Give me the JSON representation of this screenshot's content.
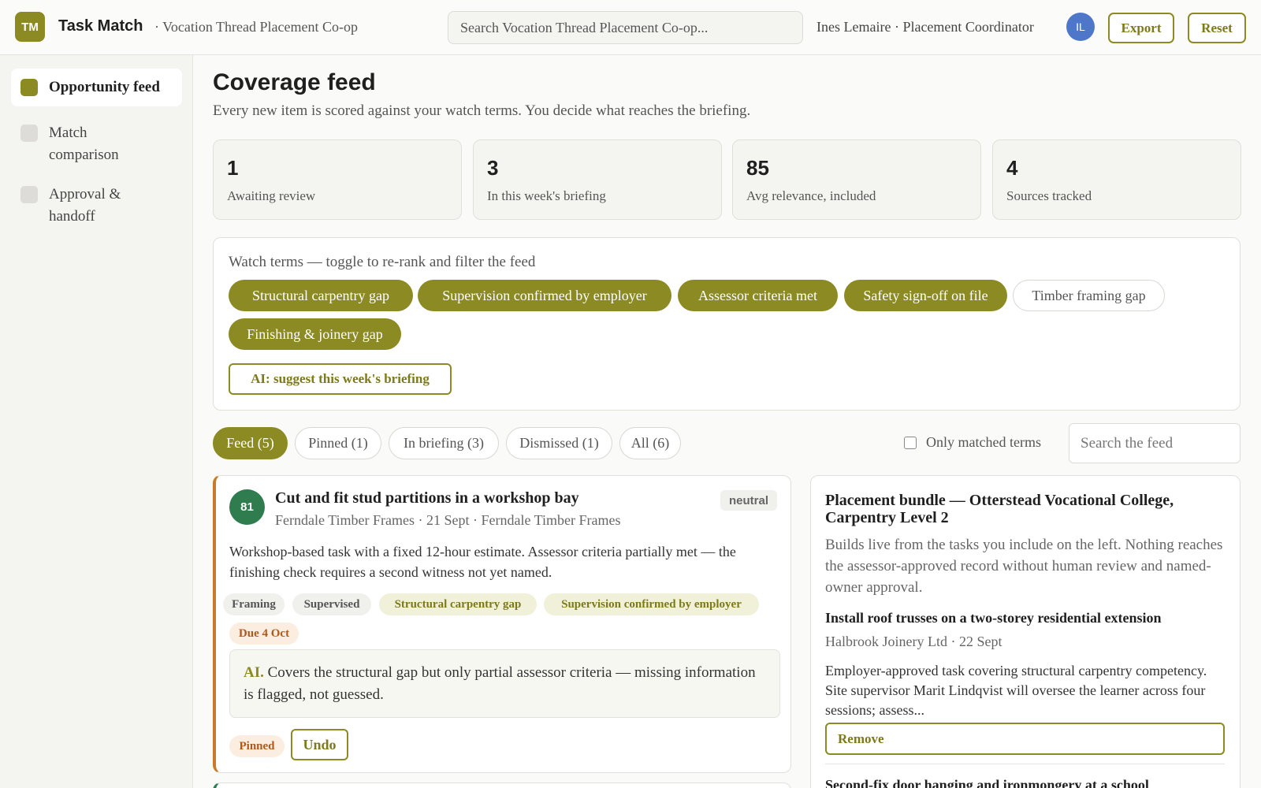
{
  "header": {
    "logo_text": "TM",
    "app_name": "Task Match",
    "org_name": "· Vocation Thread Placement Co-op",
    "search_placeholder": "Search Vocation Thread Placement Co-op...",
    "user": "Ines Lemaire · Placement Coordinator",
    "avatar_initials": "IL",
    "export_label": "Export",
    "reset_label": "Reset"
  },
  "sidebar": {
    "items": [
      {
        "label": "Opportunity feed",
        "active": true
      },
      {
        "label": "Match comparison",
        "active": false
      },
      {
        "label": "Approval & handoff",
        "active": false
      }
    ]
  },
  "main": {
    "title": "Coverage feed",
    "subtitle": "Every new item is scored against your watch terms. You decide what reaches the briefing.",
    "stats": [
      {
        "value": "1",
        "label": "Awaiting review"
      },
      {
        "value": "3",
        "label": "In this week's briefing"
      },
      {
        "value": "85",
        "label": "Avg relevance, included"
      },
      {
        "value": "4",
        "label": "Sources tracked"
      }
    ],
    "watch": {
      "title": "Watch terms — toggle to re-rank and filter the feed",
      "terms": [
        {
          "label": "Structural carpentry gap",
          "on": true
        },
        {
          "label": "Supervision confirmed by employer",
          "on": true
        },
        {
          "label": "Assessor criteria met",
          "on": true
        },
        {
          "label": "Safety sign-off on file",
          "on": true
        },
        {
          "label": "Timber framing gap",
          "on": false
        },
        {
          "label": "Finishing & joinery gap",
          "on": true
        }
      ],
      "ai_button": "AI: suggest this week's briefing"
    },
    "tabs": [
      {
        "label": "Feed (5)",
        "active": true
      },
      {
        "label": "Pinned (1)",
        "active": false
      },
      {
        "label": "In briefing (3)",
        "active": false
      },
      {
        "label": "Dismissed (1)",
        "active": false
      },
      {
        "label": "All (6)",
        "active": false
      }
    ],
    "only_matched_label": "Only matched terms",
    "feed_search_placeholder": "Search the feed"
  },
  "feed_card": {
    "score": "81",
    "title": "Cut and fit stud partitions in a workshop bay",
    "meta": "Ferndale Timber Frames · 21 Sept · Ferndale Timber Frames",
    "sentiment": "neutral",
    "description": "Workshop-based task with a fixed 12-hour estimate. Assessor criteria partially met — the finishing check requires a second witness not yet named.",
    "tags": [
      "Framing",
      "Supervised",
      "Structural carpentry gap",
      "Supervision confirmed by employer"
    ],
    "due": "Due 4 Oct",
    "ai_label": "AI.",
    "ai_note": "Covers the structural gap but only partial assessor criteria — missing information is flagged, not guessed.",
    "pinned_label": "Pinned",
    "undo_label": "Undo"
  },
  "bundle": {
    "title": "Placement bundle — Otterstead Vocational College, Carpentry Level 2",
    "subtitle": "Builds live from the tasks you include on the left. Nothing reaches the assessor-approved record without human review and named-owner approval.",
    "items": [
      {
        "title": "Install roof trusses on a two-storey residential extension",
        "meta": "Halbrook Joinery Ltd · 22 Sept",
        "description": "Employer-approved task covering structural carpentry competency. Site supervisor Marit Lindqvist will oversee the learner across four sessions; assess...",
        "remove_label": "Remove"
      },
      {
        "title": "Second-fix door hanging and ironmongery at a school"
      }
    ]
  },
  "colors": {
    "accent": "#8c8a22",
    "score_green": "#2f7d4f",
    "pinned_orange": "#c97a2a",
    "avatar_blue": "#4f77c9"
  }
}
